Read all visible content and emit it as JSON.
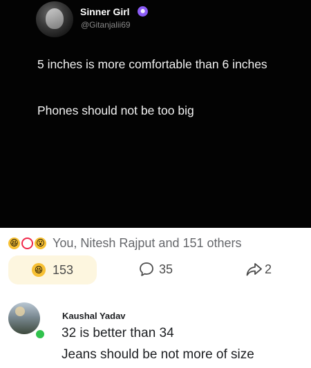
{
  "tweet": {
    "author_name": "Sinner Girl",
    "badge_icon": "devil-emoji-icon",
    "handle": "@Gitanjalii69",
    "text_line1": "5 inches is more comfortable than 6 inches",
    "text_line2": "Phones should not be too big"
  },
  "reactions": {
    "icons": [
      "laugh-emoji-icon",
      "love-heart-icon",
      "wow-emoji-icon"
    ],
    "summary": "You, Nitesh Rajput and 151 others"
  },
  "actions": {
    "like_count": "153",
    "comment_count": "35",
    "share_count": "2"
  },
  "comment": {
    "author_name": "Kaushal Yadav",
    "line1": "32 is better than 34",
    "line2": "Jeans should be not more of size"
  },
  "colors": {
    "tweet_background": "#030303",
    "like_pill": "#fdf6df",
    "online_indicator": "#31c24d",
    "love_reaction": "#f0284a",
    "emoji_yellow": "#f7c033"
  }
}
